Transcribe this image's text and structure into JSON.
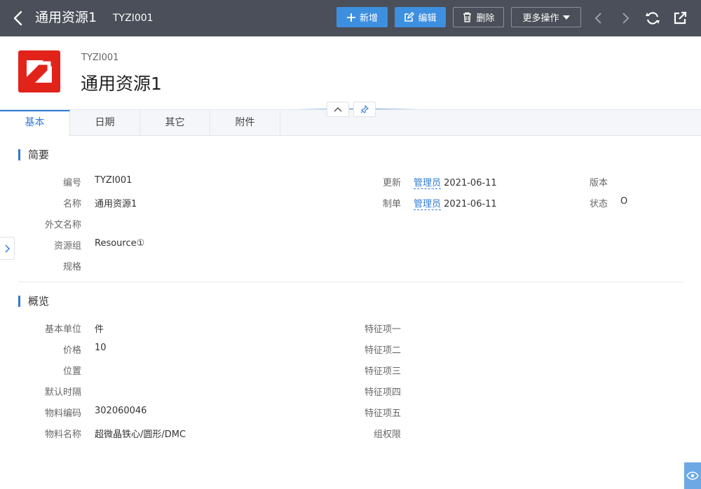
{
  "topbar": {
    "title": "通用资源1",
    "code": "TYZI001",
    "add_label": "新增",
    "edit_label": "编辑",
    "delete_label": "删除",
    "more_label": "更多操作"
  },
  "header": {
    "code": "TYZI001",
    "name": "通用资源1"
  },
  "tabs": [
    {
      "label": "基本"
    },
    {
      "label": "日期"
    },
    {
      "label": "其它"
    },
    {
      "label": "附件"
    }
  ],
  "summary": {
    "title": "简要",
    "left": [
      {
        "label": "编号",
        "value": "TYZI001"
      },
      {
        "label": "名称",
        "value": "通用资源1"
      },
      {
        "label": "外文名称",
        "value": ""
      },
      {
        "label": "资源组",
        "value": "Resource①"
      },
      {
        "label": "规格",
        "value": ""
      }
    ],
    "middle": [
      {
        "label": "更新",
        "user": "管理员",
        "date": "2021-06-11"
      },
      {
        "label": "制单",
        "user": "管理员",
        "date": "2021-06-11"
      }
    ],
    "right": [
      {
        "label": "版本",
        "value": ""
      },
      {
        "label": "状态",
        "value": "O"
      }
    ]
  },
  "overview": {
    "title": "概览",
    "left": [
      {
        "label": "基本单位",
        "value": "件"
      },
      {
        "label": "价格",
        "value": "10"
      },
      {
        "label": "位置",
        "value": ""
      },
      {
        "label": "默认时隔",
        "value": ""
      },
      {
        "label": "物料编码",
        "value": "302060046"
      },
      {
        "label": "物料名称",
        "value": "超微晶铁心/圆形/DMC"
      }
    ],
    "right": [
      {
        "label": "特征项一",
        "value": ""
      },
      {
        "label": "特征项二",
        "value": ""
      },
      {
        "label": "特征项三",
        "value": ""
      },
      {
        "label": "特征项四",
        "value": ""
      },
      {
        "label": "特征项五",
        "value": ""
      },
      {
        "label": "组权限",
        "value": ""
      }
    ]
  },
  "colors": {
    "topbar": "#4a4f59",
    "primary": "#3d8fe0",
    "logo": "#e2231a"
  }
}
